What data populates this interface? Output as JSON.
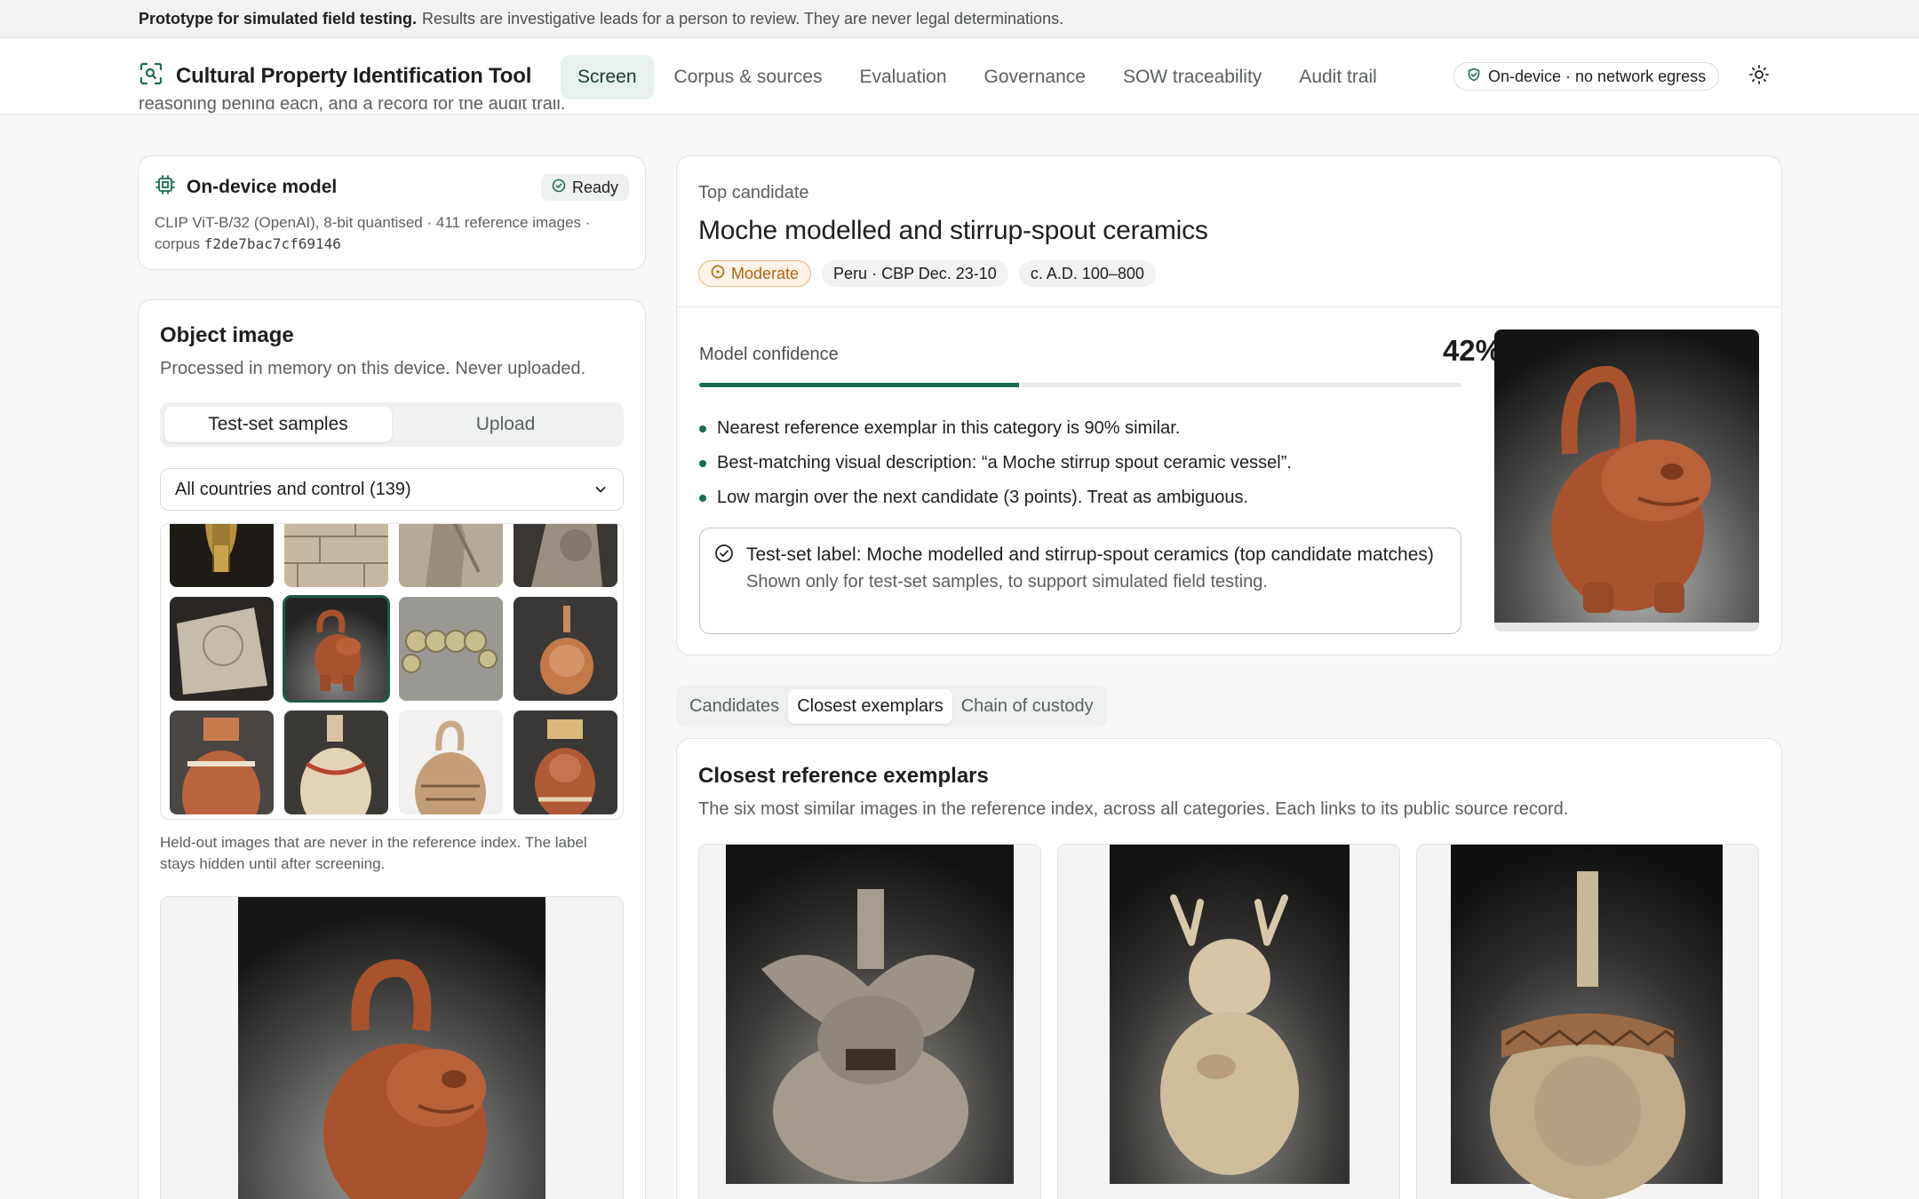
{
  "banner": {
    "strong": "Prototype for simulated field testing.",
    "text": "Results are investigative leads for a person to review. They are never legal determinations."
  },
  "nav": {
    "title": "Cultural Property Identification Tool",
    "tabs": [
      "Screen",
      "Corpus & sources",
      "Evaluation",
      "Governance",
      "SOW traceability",
      "Audit trail"
    ],
    "active_tab": "Screen",
    "egress": "On-device · no network egress"
  },
  "intro_clipped": "reasoning behind each, and a record for the audit trail.",
  "model": {
    "title": "On-device model",
    "status": "Ready",
    "desc": "CLIP ViT-B/32 (OpenAI), 8-bit quantised · 411 reference images ·",
    "corpus_label": "corpus",
    "corpus_hash": "f2de7bac7cf69146"
  },
  "object": {
    "title": "Object image",
    "subtitle": "Processed in memory on this device. Never uploaded.",
    "seg": [
      "Test-set samples",
      "Upload"
    ],
    "select_value": "All countries and control (139)",
    "grid_note": "Held-out images that are never in the reference index. The label stays hidden until after screening."
  },
  "top": {
    "eyebrow": "Top candidate",
    "title": "Moche modelled and stirrup-spout ceramics",
    "chips": [
      "Moderate",
      "Peru · CBP Dec. 23-10",
      "c. A.D. 100–800"
    ],
    "confidence_label": "Model confidence",
    "confidence_text": "42%",
    "confidence": 0.42,
    "bullets": [
      "Nearest reference exemplar in this category is 90% similar.",
      "Best-matching visual description: “a Moche stirrup spout ceramic vessel”.",
      "Low margin over the next candidate (3 points). Treat as ambiguous."
    ],
    "label_main": "Test-set label: Moche modelled and stirrup-spout ceramics (top candidate matches)",
    "label_sub": "Shown only for test-set samples, to support simulated field testing."
  },
  "subtabs": [
    "Candidates",
    "Closest exemplars",
    "Chain of custody"
  ],
  "exemplars": {
    "title": "Closest reference exemplars",
    "subtitle": "The six most similar images in the reference index, across all categories. Each links to its public source record."
  },
  "colors": {
    "accent": "#1d6b52",
    "moderate": "#b06513",
    "terracotta": "#a8532d"
  }
}
